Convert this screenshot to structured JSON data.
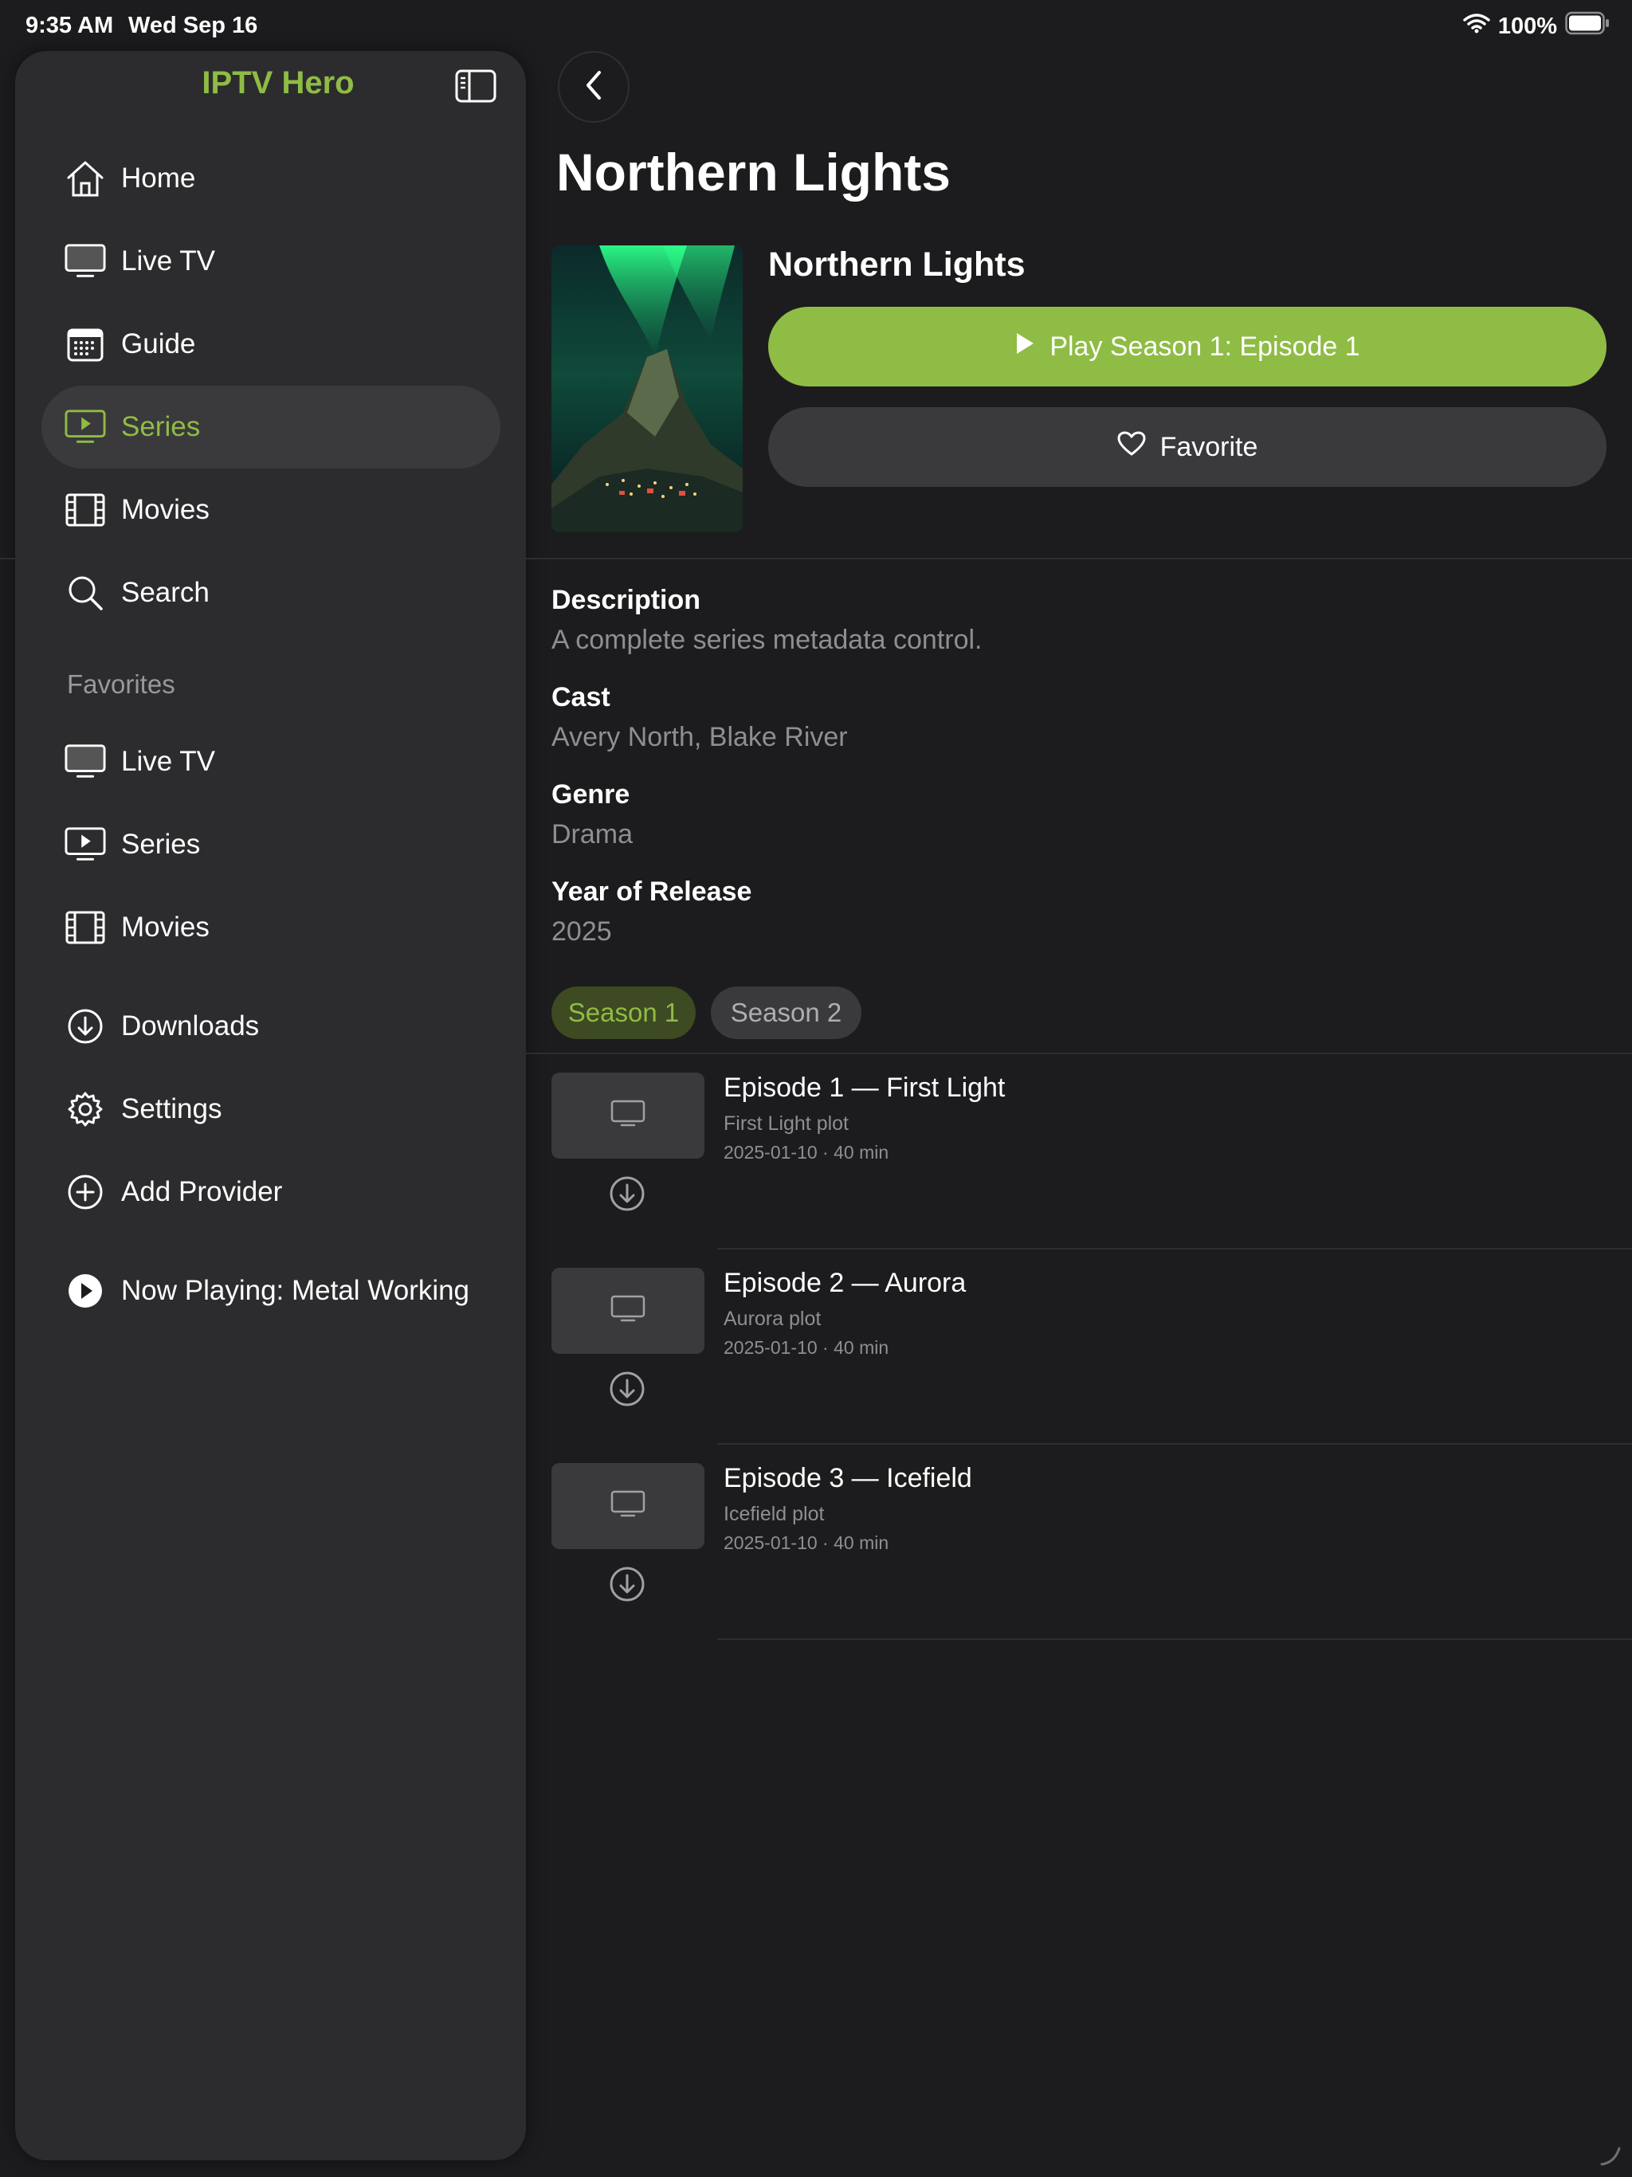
{
  "status_bar": {
    "time": "9:35 AM",
    "date": "Wed Sep 16",
    "battery": "100%"
  },
  "sidebar": {
    "title": "IPTV Hero",
    "items": [
      {
        "label": "Home"
      },
      {
        "label": "Live TV"
      },
      {
        "label": "Guide"
      },
      {
        "label": "Series"
      },
      {
        "label": "Movies"
      },
      {
        "label": "Search"
      }
    ],
    "favorites_heading": "Favorites",
    "favorites": [
      {
        "label": "Live TV"
      },
      {
        "label": "Series"
      },
      {
        "label": "Movies"
      }
    ],
    "extras": [
      {
        "label": "Downloads"
      },
      {
        "label": "Settings"
      },
      {
        "label": "Add Provider"
      }
    ],
    "now_playing": "Now Playing: Metal Working",
    "accent_color": "#8fbc45"
  },
  "main": {
    "page_title": "Northern Lights",
    "series_name": "Northern Lights",
    "play_label": "Play Season 1: Episode 1",
    "favorite_label": "Favorite",
    "meta": [
      {
        "label": "Description",
        "value": "A complete series metadata control."
      },
      {
        "label": "Cast",
        "value": "Avery North, Blake River"
      },
      {
        "label": "Genre",
        "value": "Drama"
      },
      {
        "label": "Year of Release",
        "value": "2025"
      }
    ],
    "seasons": [
      {
        "label": "Season 1"
      },
      {
        "label": "Season 2"
      }
    ],
    "episodes": [
      {
        "title": "Episode 1 — First Light",
        "plot": "First Light plot",
        "info": "2025-01-10 · 40 min"
      },
      {
        "title": "Episode 2 — Aurora",
        "plot": "Aurora plot",
        "info": "2025-01-10 · 40 min"
      },
      {
        "title": "Episode 3 — Icefield",
        "plot": "Icefield plot",
        "info": "2025-01-10 · 40 min"
      }
    ]
  }
}
